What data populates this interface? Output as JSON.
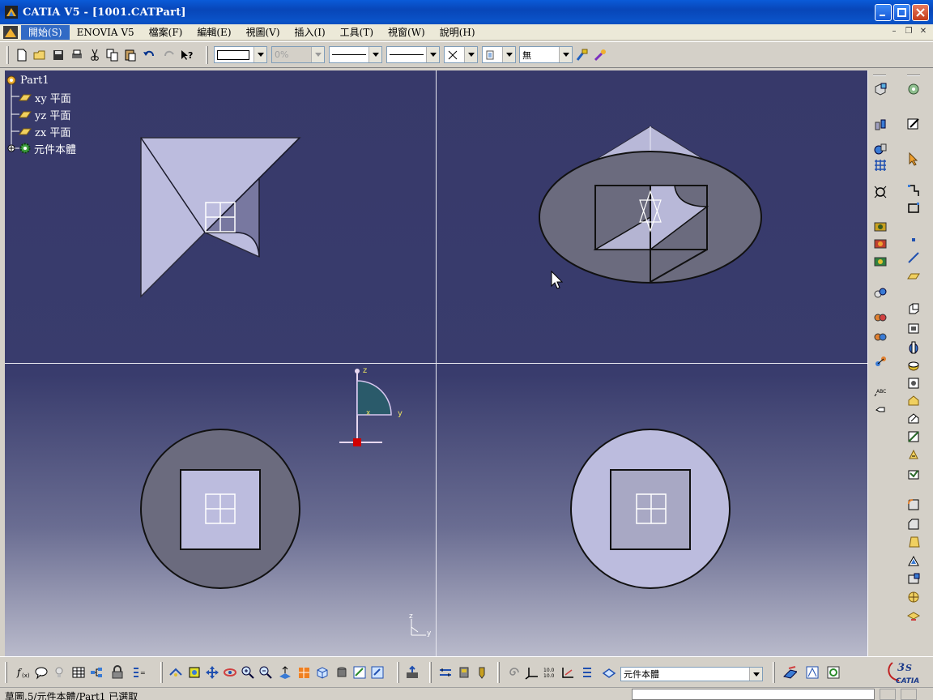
{
  "window": {
    "title": "CATIA V5 - [1001.CATPart]"
  },
  "menu": {
    "items": [
      "開始(S)",
      "ENOVIA V5",
      "檔案(F)",
      "編輯(E)",
      "視圖(V)",
      "插入(I)",
      "工具(T)",
      "視窗(W)",
      "說明(H)"
    ],
    "active_index": 0
  },
  "toolbar_top": {
    "opacity_value": "0%",
    "layer_value": "無"
  },
  "spec_tree": {
    "root": "Part1",
    "items": [
      {
        "label": "xy 平面",
        "icon": "plane-icon"
      },
      {
        "label": "yz 平面",
        "icon": "plane-icon"
      },
      {
        "label": "zx 平面",
        "icon": "plane-icon"
      },
      {
        "label": "元件本體",
        "icon": "body-gear-icon"
      }
    ]
  },
  "viewport": {
    "compass_labels": {
      "z": "z",
      "y": "y",
      "x": "x"
    },
    "axis_labels": {
      "z": "z",
      "y": "y"
    }
  },
  "toolbar_bottom": {
    "body_selector_value": "元件本體",
    "brand": "CATIA"
  },
  "status": {
    "text": "草圖.5/元件本體/Part1 已選取"
  },
  "colors": {
    "titlebar": "#0a53c8",
    "viewport_top": "#37396a",
    "part_face_light": "#bcbcde",
    "part_face_gray": "#6b6b7e",
    "selection_red": "#d00000"
  }
}
